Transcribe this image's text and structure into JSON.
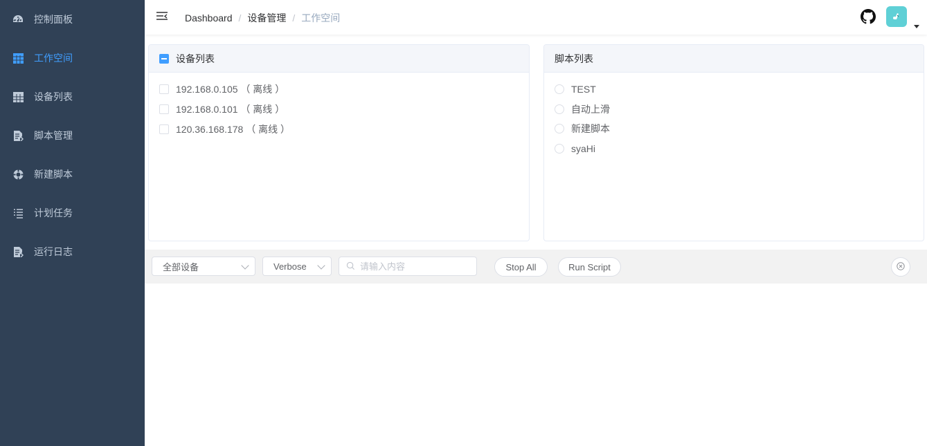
{
  "sidebar": {
    "items": [
      {
        "label": "控制面板",
        "icon": "dashboard-icon"
      },
      {
        "label": "工作空间",
        "icon": "grid-icon",
        "active": true
      },
      {
        "label": "设备列表",
        "icon": "table-icon"
      },
      {
        "label": "脚本管理",
        "icon": "document-icon"
      },
      {
        "label": "新建脚本",
        "icon": "lifebuoy-icon"
      },
      {
        "label": "计划任务",
        "icon": "list-icon"
      },
      {
        "label": "运行日志",
        "icon": "document-icon"
      }
    ]
  },
  "navbar": {
    "breadcrumb": [
      "Dashboard",
      "设备管理",
      "工作空间"
    ],
    "separator": "/"
  },
  "devices": {
    "title": "设备列表",
    "items": [
      "192.168.0.105 （ 离线 ）",
      "192.168.0.101 （ 离线 ）",
      "120.36.168.178 （ 离线 ）"
    ]
  },
  "scripts": {
    "title": "脚本列表",
    "items": [
      "TEST",
      "自动上滑",
      "新建脚本",
      "syaHi"
    ]
  },
  "toolbar": {
    "device_select": "全部设备",
    "level_select": "Verbose",
    "search_placeholder": "请输入内容",
    "stop_label": "Stop All",
    "run_label": "Run Script"
  },
  "colors": {
    "sidebar_bg": "#304156",
    "sidebar_text": "#bfcbd9",
    "accent": "#409eff",
    "avatar_bg": "#5fd0d6"
  }
}
